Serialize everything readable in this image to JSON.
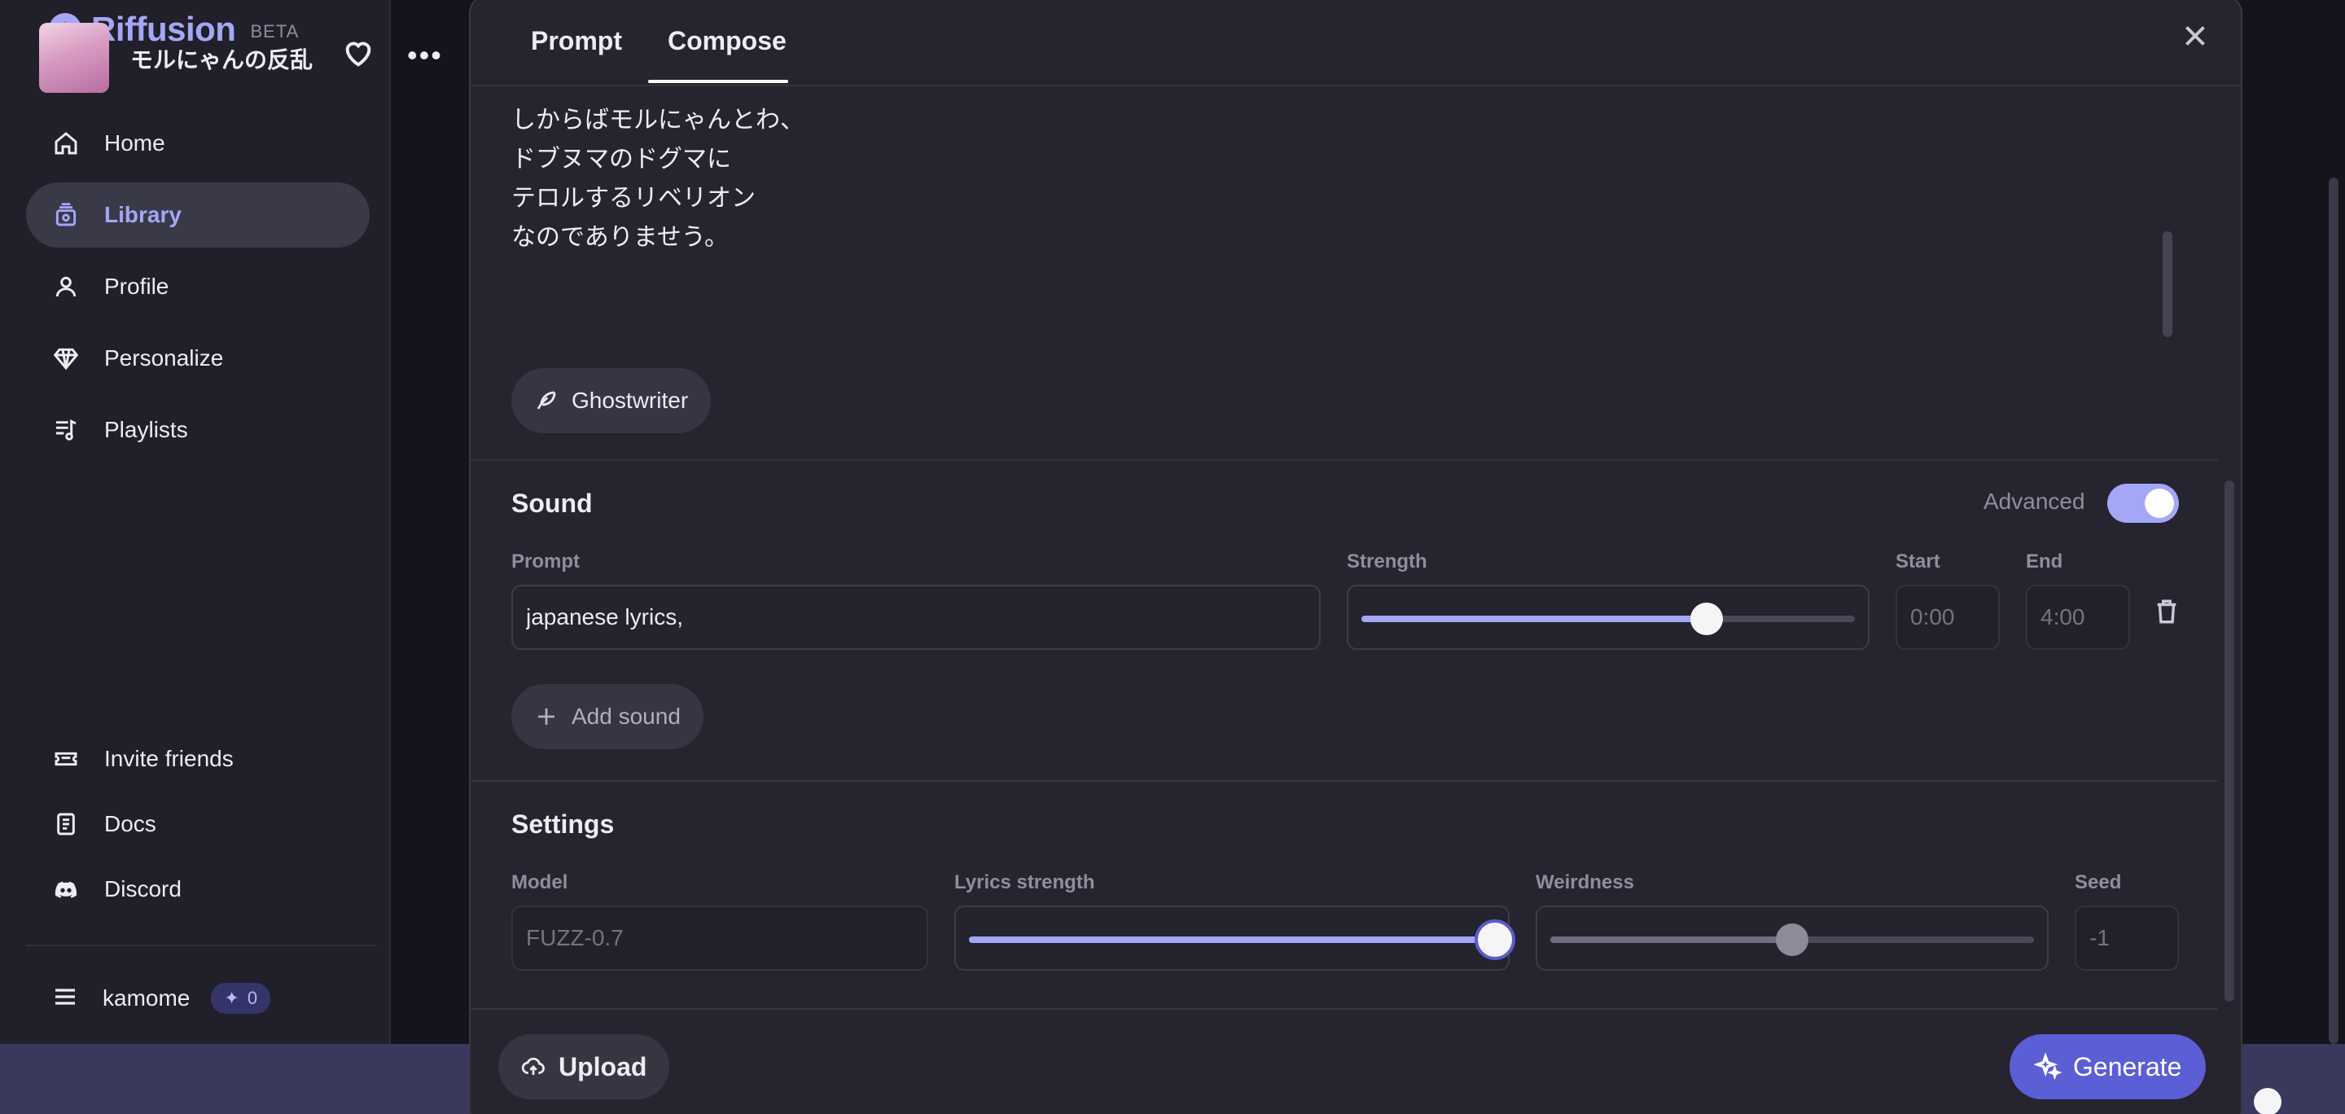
{
  "sidebar": {
    "brand": "Riffusion",
    "brand_badge": "BETA",
    "nav_top": [
      {
        "label": "Home",
        "icon": "home-icon"
      },
      {
        "label": "Library",
        "icon": "library-icon",
        "active": true
      },
      {
        "label": "Profile",
        "icon": "user-icon"
      },
      {
        "label": "Personalize",
        "icon": "diamond-icon"
      },
      {
        "label": "Playlists",
        "icon": "playlist-icon"
      }
    ],
    "nav_bottom": [
      {
        "label": "Invite friends",
        "icon": "ticket-icon"
      },
      {
        "label": "Docs",
        "icon": "document-icon"
      },
      {
        "label": "Discord",
        "icon": "discord-icon"
      }
    ],
    "user": {
      "name": "kamome",
      "credits": "0"
    }
  },
  "player": {
    "track_title": "モルにゃんの反乱"
  },
  "modal": {
    "tabs": [
      {
        "label": "Prompt",
        "active": false
      },
      {
        "label": "Compose",
        "active": true
      }
    ],
    "lyrics": [
      "しからばモルにゃんとわ、",
      "ドブヌマのドグマに",
      "テロルするリベリオン",
      "なのでありませう。"
    ],
    "ghostwriter_label": "Ghostwriter",
    "sound": {
      "title": "Sound",
      "advanced_label": "Advanced",
      "advanced_on": true,
      "prompt_label": "Prompt",
      "prompt_value": "japanese lyrics,",
      "strength_label": "Strength",
      "strength_value": 0.7,
      "start_label": "Start",
      "start_placeholder": "0:00",
      "end_label": "End",
      "end_placeholder": "4:00",
      "add_sound_label": "Add sound"
    },
    "settings": {
      "title": "Settings",
      "model_label": "Model",
      "model_placeholder": "FUZZ-0.7",
      "lyrics_strength_label": "Lyrics strength",
      "lyrics_strength_value": 1.0,
      "weirdness_label": "Weirdness",
      "weirdness_value": 0.5,
      "seed_label": "Seed",
      "seed_placeholder": "-1"
    },
    "upload_label": "Upload",
    "generate_label": "Generate"
  },
  "colors": {
    "accent": "#a4a6f6",
    "generate": "#5c5ed6",
    "background": "#15141c",
    "panel": "#25242f"
  }
}
